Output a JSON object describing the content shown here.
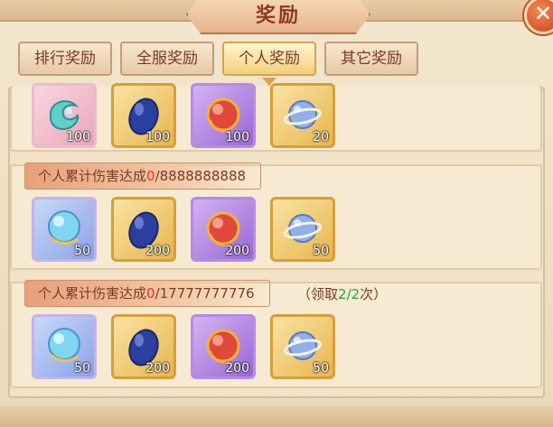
{
  "window": {
    "title": "奖励",
    "close_label": "✕"
  },
  "tabs": [
    {
      "label": "排行奖励",
      "active": false
    },
    {
      "label": "全服奖励",
      "active": false
    },
    {
      "label": "个人奖励",
      "active": true
    },
    {
      "label": "其它奖励",
      "active": false
    }
  ],
  "rows": [
    {
      "title_prefix": "",
      "progress_current": "",
      "progress_sep": "",
      "progress_target": "",
      "claim": null,
      "items": [
        {
          "icon": "jade-dragon-icon",
          "rarity": "pink",
          "count": "100"
        },
        {
          "icon": "sapphire-gem-icon",
          "rarity": "gold",
          "count": "100"
        },
        {
          "icon": "fire-orb-icon",
          "rarity": "purple",
          "count": "100"
        },
        {
          "icon": "planet-orb-icon",
          "rarity": "gold",
          "count": "20"
        }
      ]
    },
    {
      "title_prefix": "个人累计伤害达成",
      "progress_current": "0",
      "progress_sep": "/",
      "progress_target": "8888888888",
      "claim": null,
      "items": [
        {
          "icon": "crystal-orb-icon",
          "rarity": "blue",
          "count": "50"
        },
        {
          "icon": "sapphire-gem-icon",
          "rarity": "gold",
          "count": "200"
        },
        {
          "icon": "fire-orb-icon",
          "rarity": "purple",
          "count": "200"
        },
        {
          "icon": "planet-orb-icon",
          "rarity": "gold",
          "count": "50"
        }
      ]
    },
    {
      "title_prefix": "个人累计伤害达成",
      "progress_current": "0",
      "progress_sep": "/",
      "progress_target": "17777777776",
      "claim": {
        "open": "（领取",
        "done": "2",
        "sep": "/",
        "total": "2",
        "close": "次）"
      },
      "items": [
        {
          "icon": "crystal-orb-icon",
          "rarity": "blue",
          "count": "50"
        },
        {
          "icon": "sapphire-gem-icon",
          "rarity": "gold",
          "count": "200"
        },
        {
          "icon": "fire-orb-icon",
          "rarity": "purple",
          "count": "200"
        },
        {
          "icon": "planet-orb-icon",
          "rarity": "gold",
          "count": "50"
        }
      ]
    }
  ]
}
